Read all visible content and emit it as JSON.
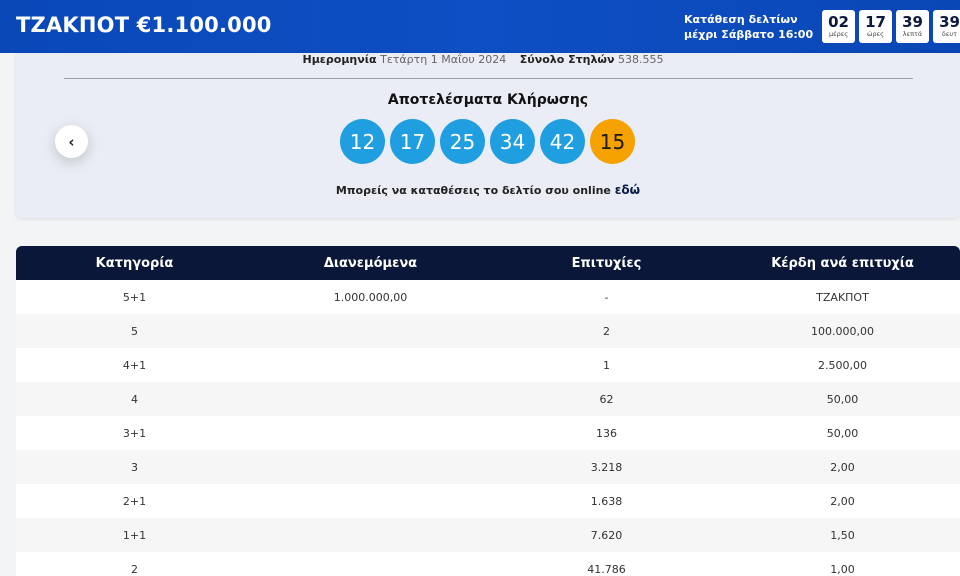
{
  "header": {
    "jackpot_title": "ΤΖΑΚΠΟΤ €1.100.000",
    "deadline_line1": "Κατάθεση δελτίων",
    "deadline_line2": "μέχρι Σάββατο 16:00",
    "countdown": [
      {
        "value": "02",
        "unit": "μέρες"
      },
      {
        "value": "17",
        "unit": "ώρες"
      },
      {
        "value": "39",
        "unit": "λεπτά"
      },
      {
        "value": "39",
        "unit": "δευτ"
      }
    ]
  },
  "results": {
    "date_label": "Ημερομηνία",
    "date_value": "Τετάρτη 1 Μαΐου 2024",
    "columns_label": "Σύνολο Στηλών",
    "columns_value": "538.555",
    "heading": "Αποτελέσματα Κλήρωσης",
    "balls": [
      "12",
      "17",
      "25",
      "34",
      "42"
    ],
    "bonus_ball": "15",
    "online_text": "Μπορείς να καταθέσεις το δελτίο σου online",
    "online_link": "εδώ",
    "prev_icon": "‹"
  },
  "table": {
    "headers": [
      "Κατηγορία",
      "Διανεμόμενα",
      "Επιτυχίες",
      "Κέρδη ανά επιτυχία"
    ],
    "rows": [
      [
        "5+1",
        "1.000.000,00",
        "-",
        "ΤΖΑΚΠΟΤ"
      ],
      [
        "5",
        "",
        "2",
        "100.000,00"
      ],
      [
        "4+1",
        "",
        "1",
        "2.500,00"
      ],
      [
        "4",
        "",
        "62",
        "50,00"
      ],
      [
        "3+1",
        "",
        "136",
        "50,00"
      ],
      [
        "3",
        "",
        "3.218",
        "2,00"
      ],
      [
        "2+1",
        "",
        "1.638",
        "2,00"
      ],
      [
        "1+1",
        "",
        "7.620",
        "1,50"
      ],
      [
        "2",
        "",
        "41.786",
        "1,00"
      ]
    ]
  },
  "colors": {
    "header_blue": "#0a48b8",
    "ball_blue": "#1f9ee0",
    "bonus_orange": "#f5a100",
    "table_header_navy": "#0b1739"
  }
}
